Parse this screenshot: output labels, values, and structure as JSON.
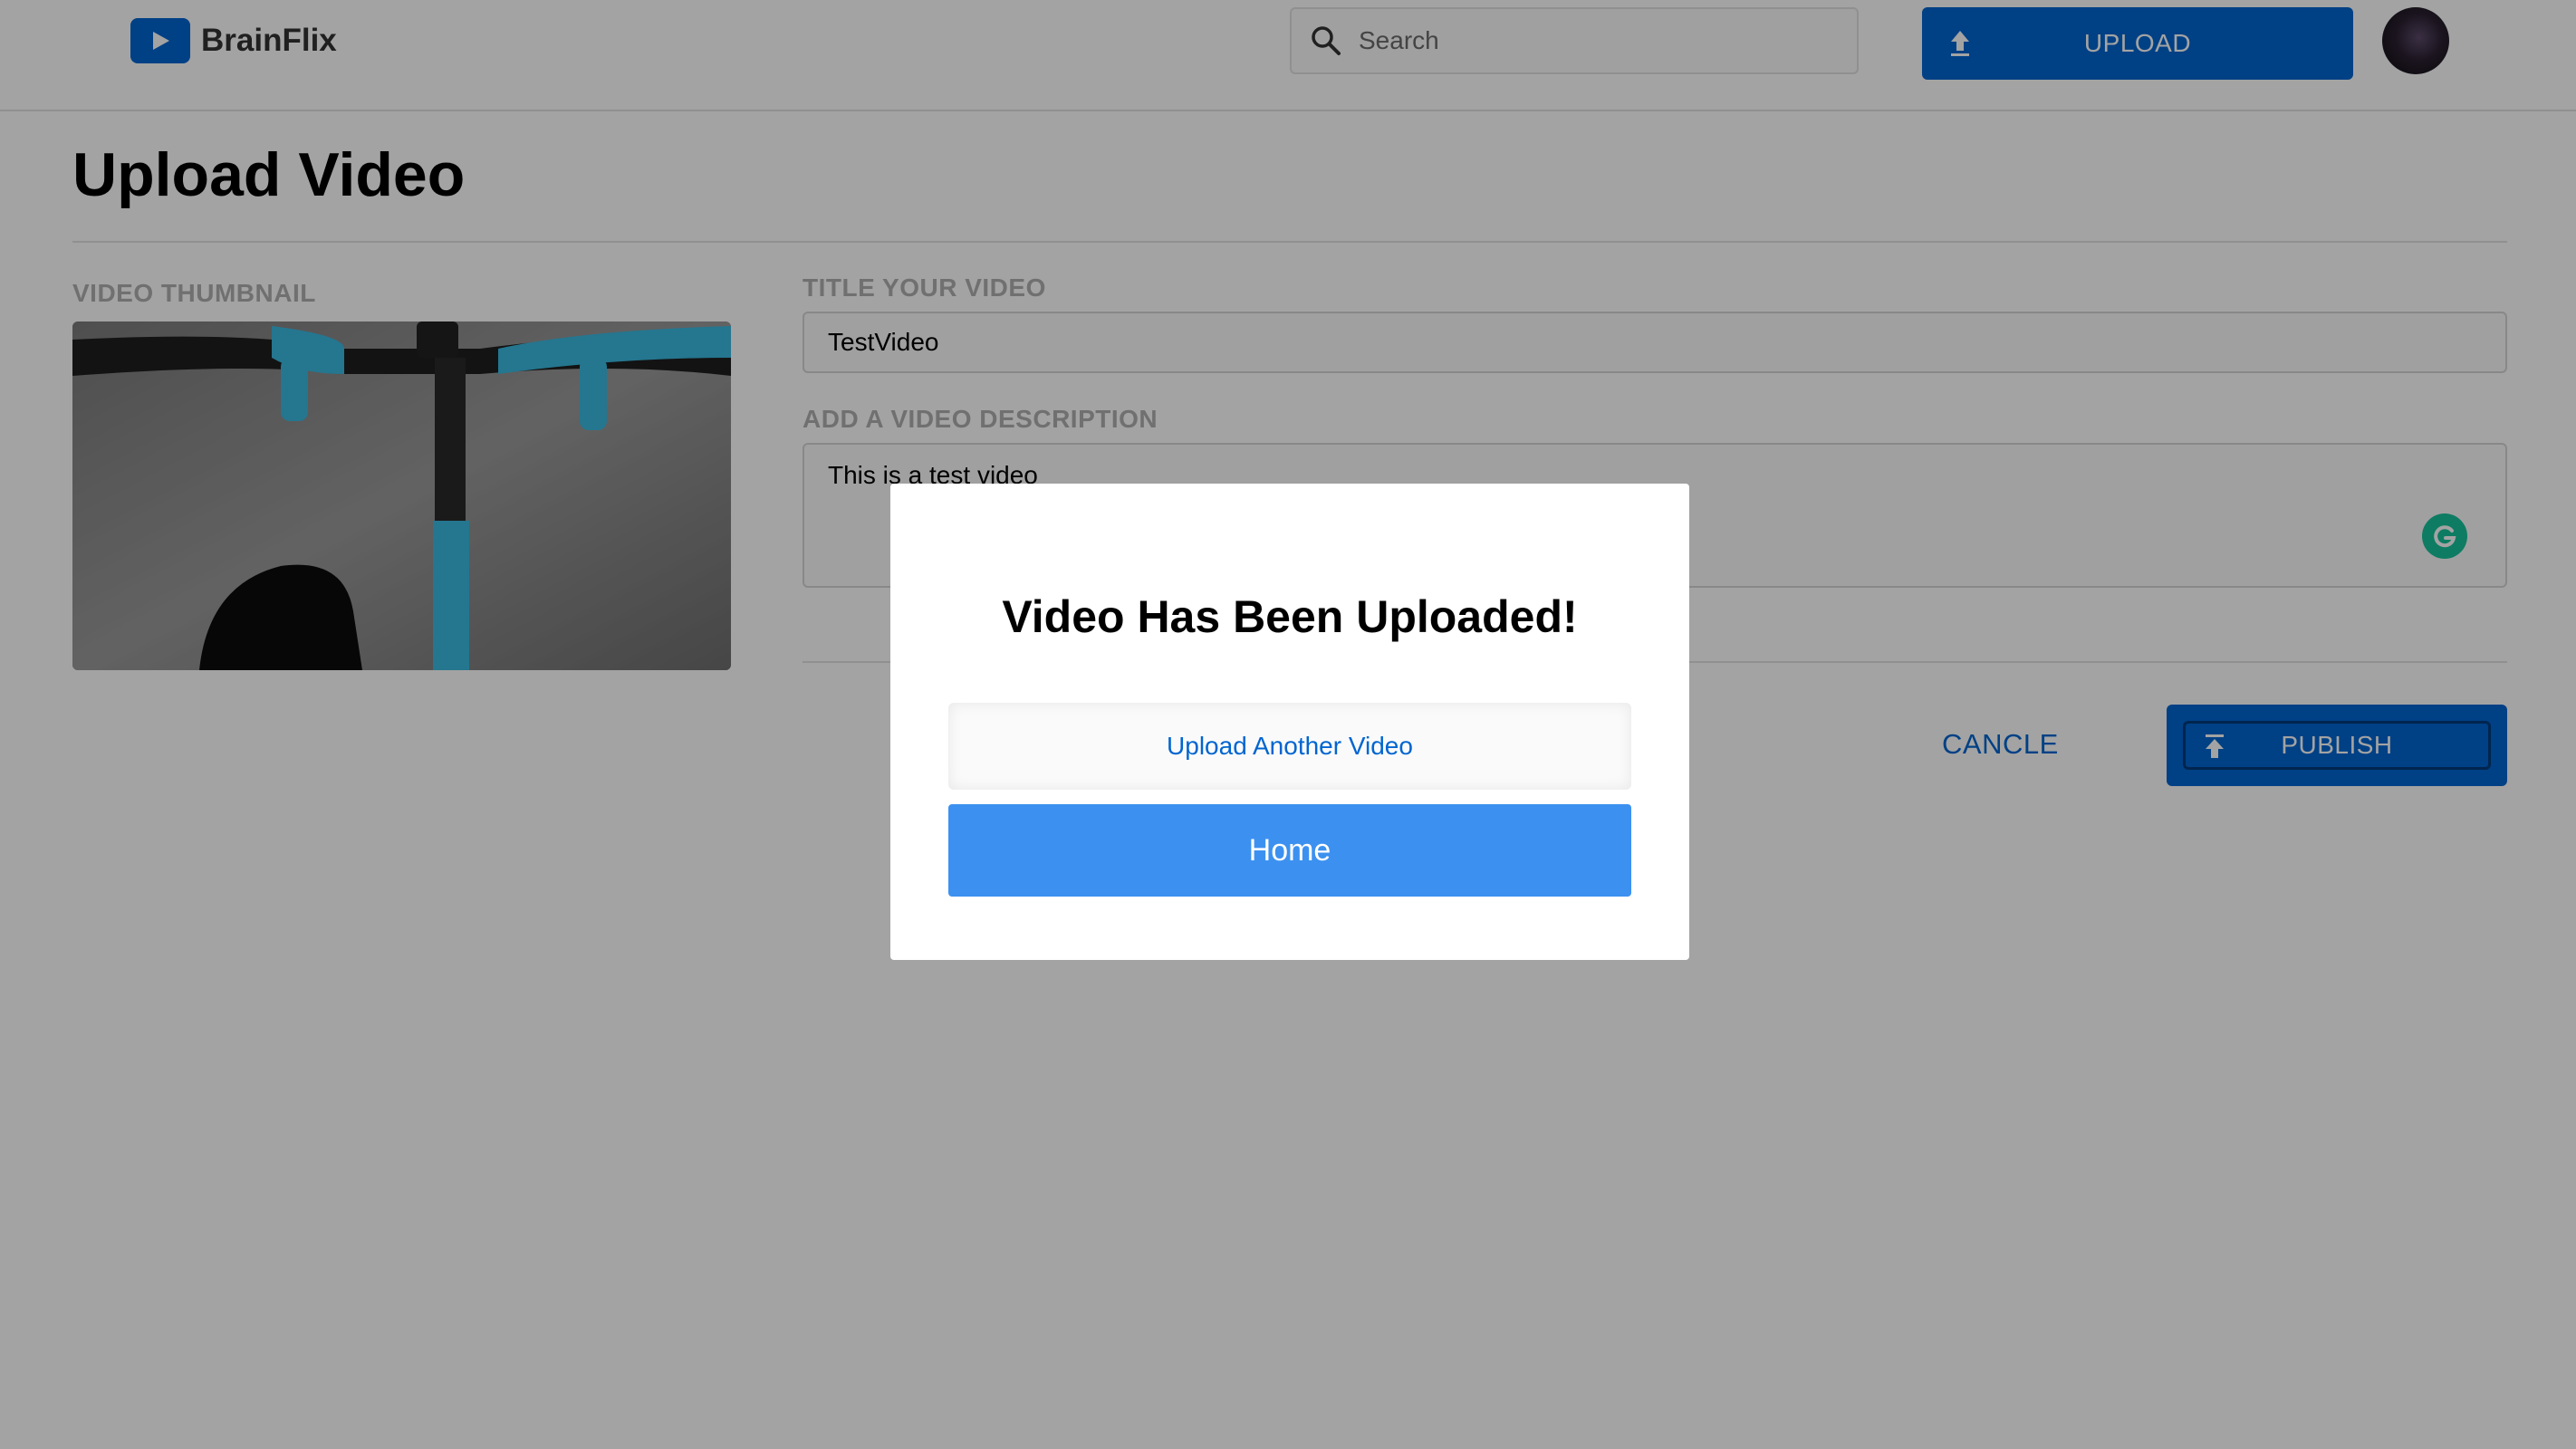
{
  "app": {
    "name": "BrainFlix"
  },
  "header": {
    "search_placeholder": "Search",
    "upload_label": "UPLOAD"
  },
  "page": {
    "title": "Upload Video",
    "thumbnail_label": "VIDEO THUMBNAIL",
    "title_label": "TITLE YOUR VIDEO",
    "title_value": "TestVideo",
    "description_label": "ADD A VIDEO DESCRIPTION",
    "description_value": "This is a test video",
    "cancel_label": "CANCLE",
    "publish_label": "PUBLISH"
  },
  "modal": {
    "title": "Video Has Been Uploaded!",
    "secondary_label": "Upload Another Video",
    "primary_label": "Home"
  },
  "colors": {
    "brand": "#0065d0",
    "modal_primary": "#3c91f0",
    "grammarly": "#15c39a"
  }
}
